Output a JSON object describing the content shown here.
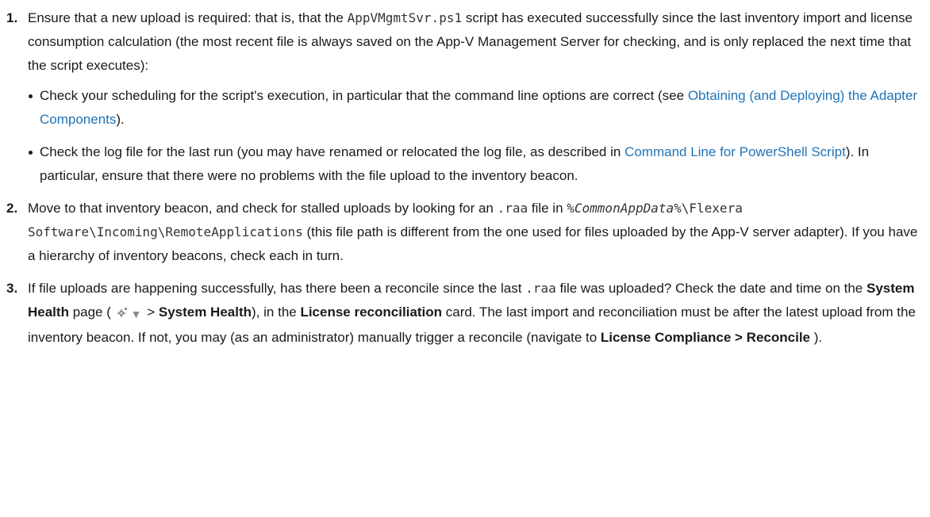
{
  "steps": [
    {
      "num": "1.",
      "t1": "Ensure that a new upload is required: that is, that the ",
      "code": "AppVMgmtSvr.ps1",
      "t2": " script has executed successfully since the last inventory import and license consumption calculation (the most recent file is always saved on the App-V Management Server for checking, and is only replaced the next time that the script executes):",
      "bullets": [
        {
          "t1": "Check your scheduling for the script's execution, in particular that the command line options are correct (see ",
          "link": "Obtaining (and Deploying) the Adapter Components",
          "t2": ")."
        },
        {
          "t1": "Check the log file for the last run (you may have renamed or relocated the log file, as described in ",
          "link": "Command Line for PowerShell Script",
          "t2": "). In particular, ensure that there were no problems with the file upload to the inventory beacon."
        }
      ]
    },
    {
      "num": "2.",
      "t1": "Move to that inventory beacon, and check for stalled uploads by looking for an ",
      "code": ".raa",
      "t2": " file in ",
      "path_var": "%CommonAppData%",
      "path_rest": "\\Flexera Software\\Incoming\\RemoteApplications",
      "t3": " (this file path is different from the one used for files uploaded by the App-V server adapter). If you have a hierarchy of inventory beacons, check each in turn."
    },
    {
      "num": "3.",
      "t1": "If file uploads are happening successfully, has there been a reconcile since the last ",
      "code": ".raa",
      "t2": " file was uploaded? Check the date and time on the ",
      "b1": "System Health",
      "t3": " page ( ",
      "menu_arrow": "▼",
      "t4": " > ",
      "b2": "System Health",
      "t5": "), in the ",
      "b3": "License reconciliation",
      "t6": " card. The last import and reconciliation must be after the latest upload from the inventory beacon. If not, you may (as an administrator) manually trigger a reconcile (navigate to ",
      "b4": "License Compliance > Reconcile",
      "t7": " )."
    }
  ],
  "colors": {
    "text": "#1a1a1a",
    "link": "#1f73b7",
    "icon": "#8a8a8a"
  },
  "icons": {
    "settings": "gear-icon",
    "menu": "dropdown-arrow-icon"
  }
}
